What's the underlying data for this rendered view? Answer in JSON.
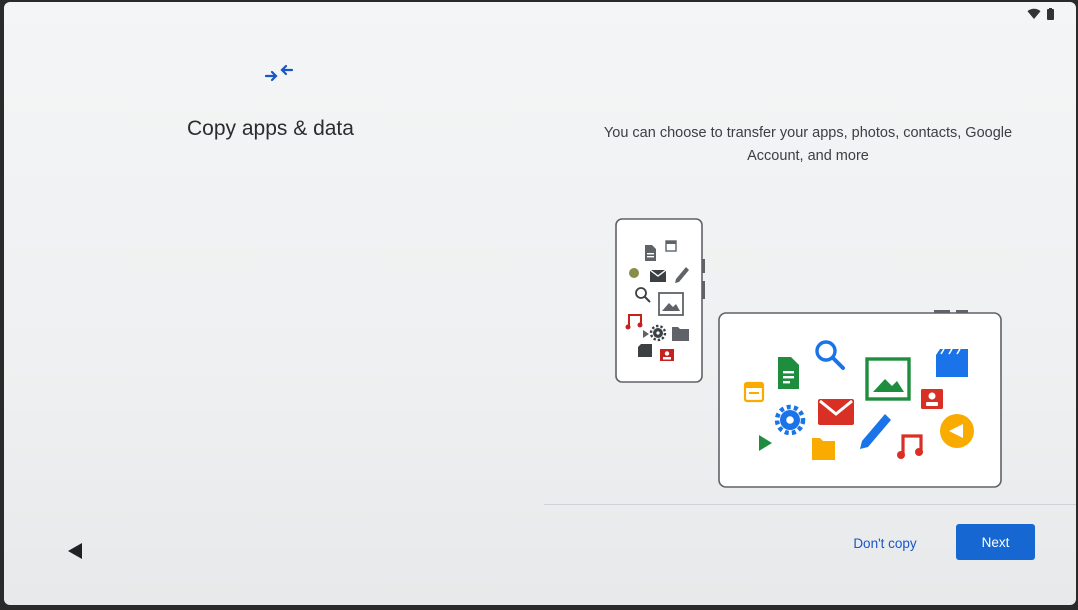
{
  "status_bar": {
    "icons": [
      "wifi-icon",
      "battery-icon"
    ]
  },
  "header": {
    "icon": "transfer-icon",
    "title": "Copy apps & data"
  },
  "main": {
    "description": "You can choose to transfer your apps, photos, contacts, Google Account, and more",
    "illustration": {
      "phone_icons": [
        "document-icon",
        "calendar-icon",
        "audio-icon",
        "mail-icon",
        "pencil-icon",
        "search-icon",
        "image-icon",
        "music-icon",
        "play-icon",
        "settings-icon",
        "folder-icon",
        "video-icon",
        "contact-icon"
      ],
      "tablet_icons": [
        "calendar-icon",
        "document-icon",
        "search-icon",
        "image-icon",
        "video-icon",
        "contact-icon",
        "settings-icon",
        "mail-icon",
        "pencil-icon",
        "play-icon",
        "folder-icon",
        "music-icon",
        "audio-icon"
      ]
    }
  },
  "footer": {
    "back_icon": "back-arrow-icon",
    "dont_copy_label": "Don't copy",
    "next_label": "Next"
  },
  "colors": {
    "accent": "#1767d2",
    "link": "#1a56c4",
    "google_blue": "#1a73e8",
    "google_red": "#d93025",
    "google_yellow": "#f9ab00",
    "google_green": "#1e8e3e"
  }
}
